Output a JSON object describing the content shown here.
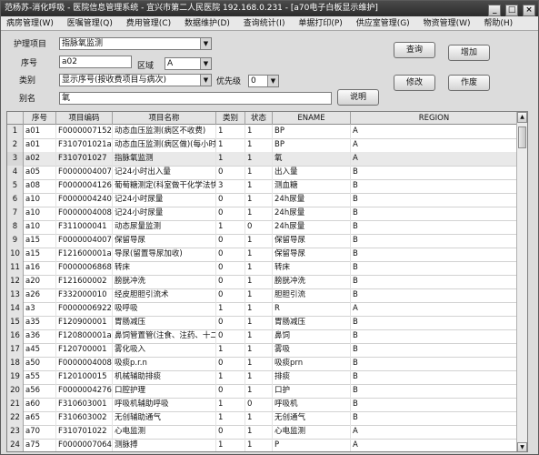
{
  "window": {
    "title": "范杨苏-消化呼吸 - 医院信息管理系统 - 宜兴市第二人民医院 192.168.0.231 - [a70电子白板显示维护]",
    "minimize": "_",
    "maximize": "□",
    "close": "×"
  },
  "menu": [
    {
      "label": "病房管理(W)"
    },
    {
      "label": "医嘱管理(Q)"
    },
    {
      "label": "费用管理(C)"
    },
    {
      "label": "数据维护(D)"
    },
    {
      "label": "查询统计(I)"
    },
    {
      "label": "单据打印(P)"
    },
    {
      "label": "供应室管理(G)"
    },
    {
      "label": "物资管理(W)"
    },
    {
      "label": "帮助(H)"
    }
  ],
  "form": {
    "nursing_item_label": "护理项目",
    "nursing_item_value": "指脉氧监测",
    "seq_label": "序号",
    "seq_value": "a02",
    "region_label": "区域",
    "region_value": "A",
    "category_label": "类别",
    "category_value": "显示序号(按收费项目与病次)",
    "priority_label": "优先级",
    "priority_value": "0",
    "alias_label": "别名",
    "alias_value": "氧",
    "query_button": "查询",
    "add_button": "增加",
    "modify_button": "修改",
    "void_button": "作废",
    "explain_button": "说明"
  },
  "grid": {
    "columns": [
      "序号",
      "项目编码",
      "项目名称",
      "类别",
      "状态",
      "ENAME",
      "REGION"
    ],
    "rows": [
      [
        "1",
        "a01",
        "F00000071520",
        "动态血压监测(病区不收费)",
        "1",
        "1",
        "BP",
        "A"
      ],
      [
        "2",
        "a01",
        "F310701021a",
        "动态血压监测(病区做)(每小时)",
        "1",
        "1",
        "BP",
        "A"
      ],
      [
        "3",
        "a02",
        "F310701027",
        "指脉氧监测",
        "1",
        "1",
        "氧",
        "A"
      ],
      [
        "4",
        "a05",
        "F00000040077",
        "记24小时出入量",
        "0",
        "1",
        "出入量",
        "B"
      ],
      [
        "5",
        "a08",
        "F00000041260",
        "葡萄糖测定(科室做干化学法快速)",
        "3",
        "1",
        "测血糖",
        "B"
      ],
      [
        "6",
        "a10",
        "F00000042405",
        "记24小时尿量",
        "0",
        "1",
        "24h尿量",
        "B"
      ],
      [
        "7",
        "a10",
        "F00000040083",
        "记24小时尿量",
        "0",
        "1",
        "24h尿量",
        "B"
      ],
      [
        "8",
        "a10",
        "F311000041",
        "动态尿量监测",
        "1",
        "0",
        "24h尿量",
        "B"
      ],
      [
        "9",
        "a15",
        "F00000040074",
        "保留导尿",
        "0",
        "1",
        "保留导尿",
        "B"
      ],
      [
        "10",
        "a15",
        "F121600001a",
        "导尿(留置导尿加收)",
        "0",
        "1",
        "保留导尿",
        "B"
      ],
      [
        "11",
        "a16",
        "F00000068680",
        "转床",
        "0",
        "1",
        "转床",
        "B"
      ],
      [
        "12",
        "a20",
        "F121600002",
        "膀胱冲洗",
        "0",
        "1",
        "膀胱冲洗",
        "B"
      ],
      [
        "13",
        "a26",
        "F332000010",
        "经皮胆胆引流术",
        "0",
        "1",
        "胆胆引流",
        "B"
      ],
      [
        "14",
        "a3",
        "F00000069220",
        "吸呼吸",
        "1",
        "1",
        "R",
        "A"
      ],
      [
        "15",
        "a35",
        "F120900001",
        "胃肠减压",
        "0",
        "1",
        "胃肠减压",
        "B"
      ],
      [
        "16",
        "a36",
        "F120800001a",
        "鼻饲管置管(注食、注药、十二指肠)",
        "0",
        "1",
        "鼻饲",
        "B"
      ],
      [
        "17",
        "a45",
        "F120700001",
        "雾化吸入",
        "1",
        "1",
        "雾吸",
        "B"
      ],
      [
        "18",
        "a50",
        "F00000040082",
        "吸痰p.r.n",
        "0",
        "1",
        "吸痰prn",
        "B"
      ],
      [
        "19",
        "a55",
        "F120100015",
        "机械辅助排痰",
        "1",
        "1",
        "排痰",
        "B"
      ],
      [
        "20",
        "a56",
        "F00000042762",
        "口腔护理",
        "0",
        "1",
        "口护",
        "B"
      ],
      [
        "21",
        "a60",
        "F310603001",
        "呼吸机辅助呼吸",
        "1",
        "0",
        "呼吸机",
        "B"
      ],
      [
        "22",
        "a65",
        "F310603002",
        "无创辅助通气",
        "1",
        "1",
        "无创通气",
        "B"
      ],
      [
        "23",
        "a70",
        "F310701022",
        "心电监测",
        "0",
        "1",
        "心电监测",
        "A"
      ],
      [
        "24",
        "a75",
        "F00000070640",
        "测脉搏",
        "1",
        "1",
        "P",
        "A"
      ]
    ]
  },
  "scrollbar": {
    "up": "▲",
    "down": "▼"
  }
}
